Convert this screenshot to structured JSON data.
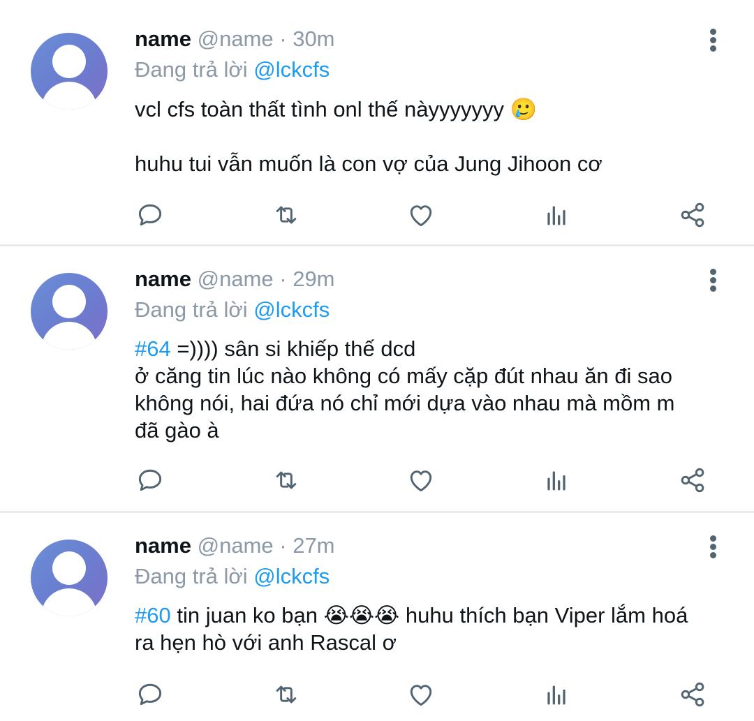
{
  "tweets": [
    {
      "name": "name",
      "handle": "@name",
      "dot": "·",
      "time": "30m",
      "reply_prefix": "Đang trả lời ",
      "reply_to": "@lckcfs",
      "lines": [
        "vcl cfs toàn thất tình onl thế nàyyyyyyy 🥲",
        "",
        "huhu tui vẫn muốn là con vợ của Jung Jihoon cơ"
      ]
    },
    {
      "name": "name",
      "handle": "@name",
      "dot": "·",
      "time": "29m",
      "reply_prefix": "Đang trả lời ",
      "reply_to": "@lckcfs",
      "hashtag": "#64",
      "text_after_hashtag": " =)))) sân si khiếp thế dcd",
      "lines": [
        "ở căng tin lúc nào không có mấy cặp đút nhau ăn đi sao",
        "không nói, hai đứa nó chỉ mới dựa vào nhau mà mồm m",
        "đã gào à"
      ]
    },
    {
      "name": "name",
      "handle": "@name",
      "dot": "·",
      "time": "27m",
      "reply_prefix": "Đang trả lời ",
      "reply_to": "@lckcfs",
      "hashtag": "#60",
      "text_after_hashtag": " tin juan ko bạn 😭😭😭 huhu thích bạn Viper lắm hoá",
      "lines": [
        "ra hẹn hò với anh Rascal ơ"
      ]
    }
  ],
  "icons": {
    "reply": "reply-icon",
    "retweet": "retweet-icon",
    "like": "like-icon",
    "views": "views-icon",
    "share": "share-icon",
    "more": "more-vertical-icon"
  },
  "colors": {
    "text": "#0f1419",
    "secondary": "#8b98a5",
    "link": "#1d9bf0",
    "icon": "#536471",
    "divider": "#e9ecef"
  }
}
